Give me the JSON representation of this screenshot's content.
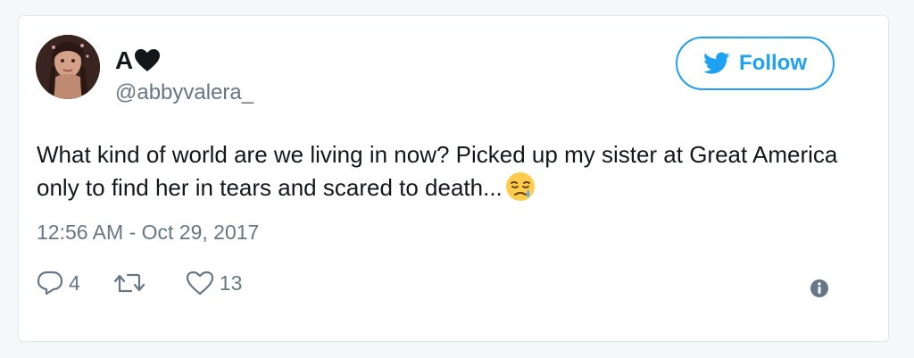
{
  "user": {
    "display_name": "A",
    "handle": "@abbyvalera_"
  },
  "follow_button": {
    "label": "Follow",
    "icon": "twitter-bird-icon"
  },
  "tweet": {
    "text": "What kind of world are we living in now? Picked up my sister at Great America only to find her in tears and scared to death...",
    "emoji": "crying-face-emoji",
    "timestamp": "12:56 AM - Oct 29, 2017"
  },
  "actions": {
    "reply_count": "4",
    "retweet_count": "",
    "like_count": "13"
  },
  "colors": {
    "accent": "#1da1f2",
    "text": "#14171a",
    "muted": "#657786",
    "border": "#e1e8ed"
  }
}
